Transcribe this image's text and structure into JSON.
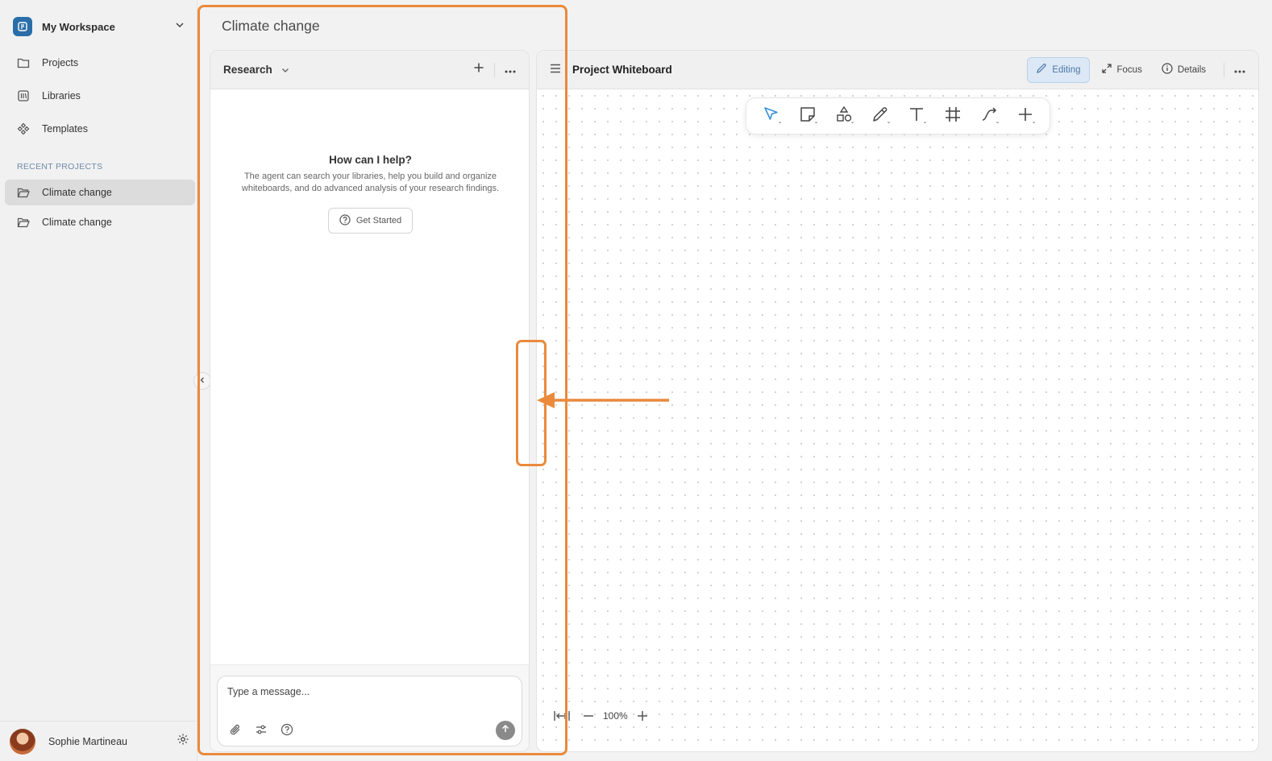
{
  "sidebar": {
    "workspace_name": "My Workspace",
    "nav": [
      {
        "label": "Projects",
        "icon": "folder-icon"
      },
      {
        "label": "Libraries",
        "icon": "library-icon"
      },
      {
        "label": "Templates",
        "icon": "templates-icon"
      }
    ],
    "recent_label": "RECENT PROJECTS",
    "recent": [
      {
        "label": "Climate change",
        "active": true
      },
      {
        "label": "Climate change",
        "active": false
      }
    ],
    "user_name": "Sophie Martineau"
  },
  "page_title": "Climate change",
  "research": {
    "title": "Research",
    "help_title": "How can I help?",
    "help_desc": "The agent can search your libraries, help you build and organize whiteboards, and do advanced analysis of your research findings.",
    "get_started": "Get Started",
    "message_placeholder": "Type a message..."
  },
  "whiteboard": {
    "title": "Project Whiteboard",
    "editing_label": "Editing",
    "focus_label": "Focus",
    "details_label": "Details",
    "zoom": "100%",
    "tools": [
      "select-tool",
      "sticky-note-tool",
      "shapes-tool",
      "pen-tool",
      "text-tool",
      "frame-tool",
      "connector-tool",
      "add-tool"
    ]
  },
  "colors": {
    "annotation": "#ea8a3c",
    "brand": "#2a6ea8",
    "editing_bg": "#dce8f5",
    "select_tool": "#3a8fd6"
  }
}
